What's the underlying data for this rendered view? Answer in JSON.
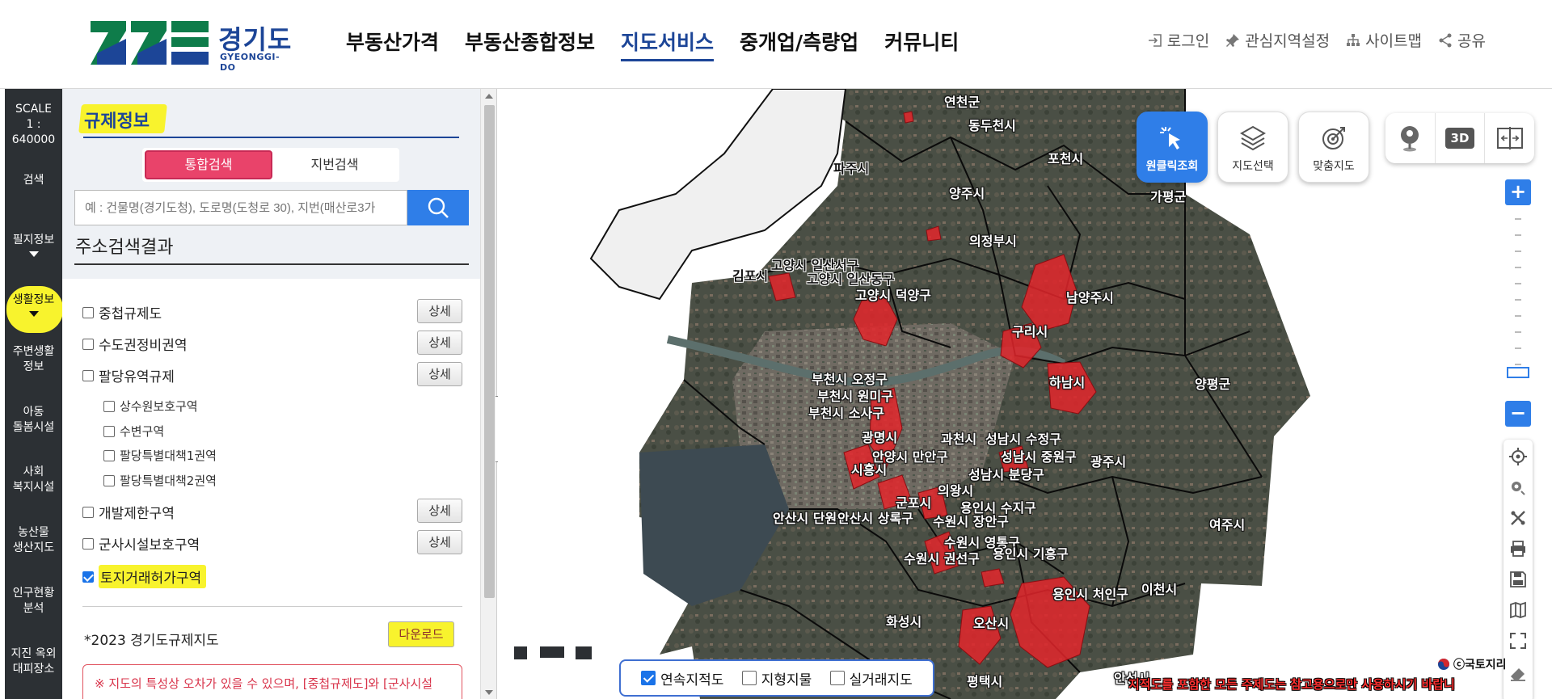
{
  "logo": {
    "ko": "경기도",
    "en": "GYEONGGI-DO"
  },
  "gnb": [
    "부동산가격",
    "부동산종합정보",
    "지도서비스",
    "중개업/측량업",
    "커뮤니티"
  ],
  "util": [
    {
      "label": "로그인",
      "icon": "login-icon"
    },
    {
      "label": "관심지역설정",
      "icon": "pin-icon"
    },
    {
      "label": "사이트맵",
      "icon": "sitemap-icon"
    },
    {
      "label": "공유",
      "icon": "share-icon"
    }
  ],
  "rail": {
    "scale_label": "SCALE",
    "scale_value": "1 : 640000",
    "items": [
      "검색",
      "필지정보",
      "생활정보",
      "주변생활\n정보",
      "아동\n돌봄시설",
      "사회\n복지시설",
      "농산물\n생산지도",
      "인구현황\n분석",
      "지진 옥외\n대피장소"
    ]
  },
  "panel": {
    "title": "규제정보",
    "tabs": [
      "통합검색",
      "지번검색"
    ],
    "search_placeholder": "예 : 건물명(경기도청), 도로명(도청로 30), 지번(매산로3가",
    "result_title": "주소검색결과",
    "detail_label": "상세",
    "items": [
      {
        "label": "중첩규제도",
        "checked": false,
        "detail": true
      },
      {
        "label": "수도권정비권역",
        "checked": false,
        "detail": true
      },
      {
        "label": "팔당유역규제",
        "checked": false,
        "detail": true
      },
      {
        "label": "상수원보호구역",
        "checked": false,
        "sub": true
      },
      {
        "label": "수변구역",
        "checked": false,
        "sub": true
      },
      {
        "label": "팔당특별대책1권역",
        "checked": false,
        "sub": true
      },
      {
        "label": "팔당특별대책2권역",
        "checked": false,
        "sub": true
      },
      {
        "label": "개발제한구역",
        "checked": false,
        "detail": true
      },
      {
        "label": "군사시설보호구역",
        "checked": false,
        "detail": true
      },
      {
        "label": "토지거래허가구역",
        "checked": true,
        "highlight": true
      }
    ],
    "download_label": "*2023 경기도규제지도",
    "download_button": "다운로드",
    "notice": "※ 지도의 특성상 오차가 있을 수 있으며, [중첩규제도]와 [군사시설"
  },
  "map": {
    "tools": [
      {
        "label": "원클릭조회",
        "icon": "click-cursor-icon",
        "active": true
      },
      {
        "label": "지도선택",
        "icon": "layers-icon",
        "active": false
      },
      {
        "label": "맞춤지도",
        "icon": "target-icon",
        "active": false
      }
    ],
    "view_3d": "3D",
    "zoom_in": "+",
    "zoom_out": "−",
    "labels": [
      "연천군",
      "동두천시",
      "포천시",
      "파주시",
      "양주시",
      "가평군",
      "의정부시",
      "고양시 일산서구",
      "고양시 일산동구",
      "김포시",
      "고양시 덕양구",
      "남양주시",
      "구리시",
      "부천시 오정구",
      "부천시 원미구",
      "부천시 소사구",
      "하남시",
      "양평군",
      "광명시",
      "과천시",
      "성남시 수정구",
      "성남시 중원구",
      "시흥시",
      "안양시 만안구",
      "광주시",
      "성남시 분당구",
      "의왕시",
      "군포시",
      "용인시 수지구",
      "안산시 단원구",
      "안산시 상록구",
      "수원시 장안구",
      "여주시",
      "수원시 영통구",
      "수원시 권선구",
      "용인시 기흥구",
      "용인시 처인구",
      "이천시",
      "화성시",
      "오산시",
      "평택시",
      "안성시"
    ],
    "layers": [
      {
        "label": "연속지적도",
        "checked": true
      },
      {
        "label": "지형지물",
        "checked": false
      },
      {
        "label": "실거래지도",
        "checked": false
      }
    ],
    "copyright": "ⓒ국토지리",
    "disclaimer": "지적도를 포함한 모든 주제도는 참고용으로만 사용하시기 바랍니"
  }
}
